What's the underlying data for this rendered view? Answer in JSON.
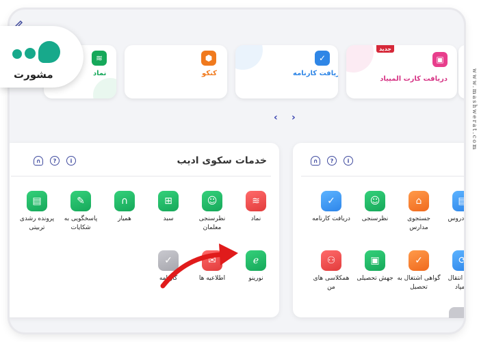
{
  "carousel": {
    "cards": [
      {
        "label": "دریافت کارت المپیاد",
        "badge": "جدید",
        "color": "#e83e8c",
        "icon": "card-icon"
      },
      {
        "label": "دریافت کارنامه",
        "color": "#2f86e6",
        "icon": "report-icon"
      },
      {
        "label": "کنکو",
        "color": "#f07a1e",
        "icon": "box-icon"
      },
      {
        "label": "نماد",
        "color": "#16a85a",
        "icon": "namad-icon"
      }
    ],
    "prev": "‹",
    "next": "›"
  },
  "left_panel": {
    "title": "خدمات سکوی ادیب",
    "header_icons": [
      "info-icon",
      "help-icon",
      "headset-icon"
    ],
    "items": [
      {
        "label": "نماد",
        "color": "red",
        "icon": "namad-icon"
      },
      {
        "label": "نظرسنجی معلمان",
        "color": "green",
        "icon": "survey-teachers-icon"
      },
      {
        "label": "سبد",
        "color": "green",
        "icon": "basket-icon"
      },
      {
        "label": "همیار",
        "color": "green",
        "icon": "headset-icon"
      },
      {
        "label": "پاسخگویی به شکایات",
        "color": "green",
        "icon": "complaint-icon"
      },
      {
        "label": "پرونده رشدی تربیتی",
        "color": "green",
        "icon": "folder-icon"
      },
      {
        "label": "نورینو",
        "color": "green",
        "icon": "noorino-icon"
      },
      {
        "label": "اطلاعیه ها",
        "color": "red",
        "icon": "announcement-icon"
      },
      {
        "label": "کارنامه",
        "color": "gray",
        "icon": "report-card-icon"
      }
    ]
  },
  "right_panel": {
    "header_icons": [
      "info-icon",
      "help-icon",
      "headset-icon"
    ],
    "items": [
      {
        "label": "دریافت کارنامه",
        "color": "blue",
        "icon": "report-icon"
      },
      {
        "label": "نظرسنجی",
        "color": "green",
        "icon": "survey-icon"
      },
      {
        "label": "جستجوی مدارس",
        "color": "orange",
        "icon": "school-search-icon"
      },
      {
        "label": "ست دروس",
        "color": "blue",
        "icon": "lessons-icon"
      },
      {
        "label": "همکلاسی های من",
        "color": "red",
        "icon": "classmates-icon"
      },
      {
        "label": "جهش تحصیلی",
        "color": "green",
        "icon": "leap-icon"
      },
      {
        "label": "گواهی اشتغال به تحصیل",
        "color": "orange",
        "icon": "certificate-icon"
      },
      {
        "label": "قل و انتقال سمپاد",
        "color": "blue",
        "icon": "transfer-icon"
      }
    ]
  },
  "logo": {
    "wordmark": "مشورت"
  },
  "watermark": "www.mashwerat.com"
}
